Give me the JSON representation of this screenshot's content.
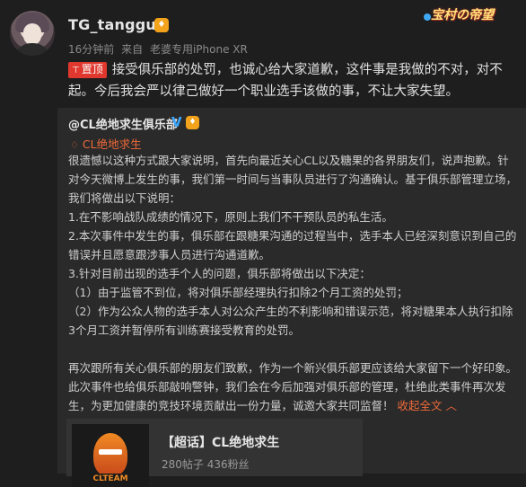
{
  "post": {
    "username": "TG_tangguo",
    "badge_icon": "vip-badge-icon",
    "time": "16分钟前",
    "source_prefix": "来自",
    "source_device": "老婆专用iPhone XR",
    "pin_label": "置顶",
    "text": "接受俱乐部的处罚，也诚心给大家道歉，这件事是我做的不对，对不起。今后我会严以律己做好一个职业选手该做的事，不让大家失望。"
  },
  "corner_logo": {
    "text": "宝村の帝望"
  },
  "repost": {
    "author": "@CL绝地求生俱乐部",
    "verified_mark": "V",
    "super_topic": "CL绝地求生",
    "paragraphs": [
      "很遗憾以这种方式跟大家说明，首先向最近关心CL以及糖果的各界朋友们，说声抱歉。针对今天微博上发生的事，我们第一时间与当事队员进行了沟通确认。基于俱乐部管理立场，我们将做出以下说明：",
      "1.在不影响战队成绩的情况下，原则上我们不干预队员的私生活。",
      "2.本次事件中发生的事，俱乐部在跟糖果沟通的过程当中，选手本人已经深刻意识到自己的错误并且愿意跟涉事人员进行沟通道歉。",
      "3.针对目前出现的选手个人的问题，俱乐部将做出以下决定：",
      "（1）由于监管不到位，将对俱乐部经理执行扣除2个月工资的处罚；",
      "（2）作为公众人物的选手本人对公众产生的不利影响和错误示范，将对糖果本人执行扣除3个月工资并暂停所有训练赛接受教育的处罚。",
      "",
      "再次跟所有关心俱乐部的朋友们致歉，作为一个新兴俱乐部更应该给大家留下一个好印象。此次事件也给俱乐部敲响警钟，我们会在今后加强对俱乐部的管理，杜绝此类事件再次发生，为更加健康的竞技环境贡献出一份力量，诚邀大家共同监督！"
    ],
    "collapse_label": "收起全文",
    "collapse_arrow": "︿"
  },
  "card": {
    "title": "【超话】CL绝地求生",
    "stats": "280帖子 436粉丝",
    "logo_text": "CLTEAM"
  }
}
